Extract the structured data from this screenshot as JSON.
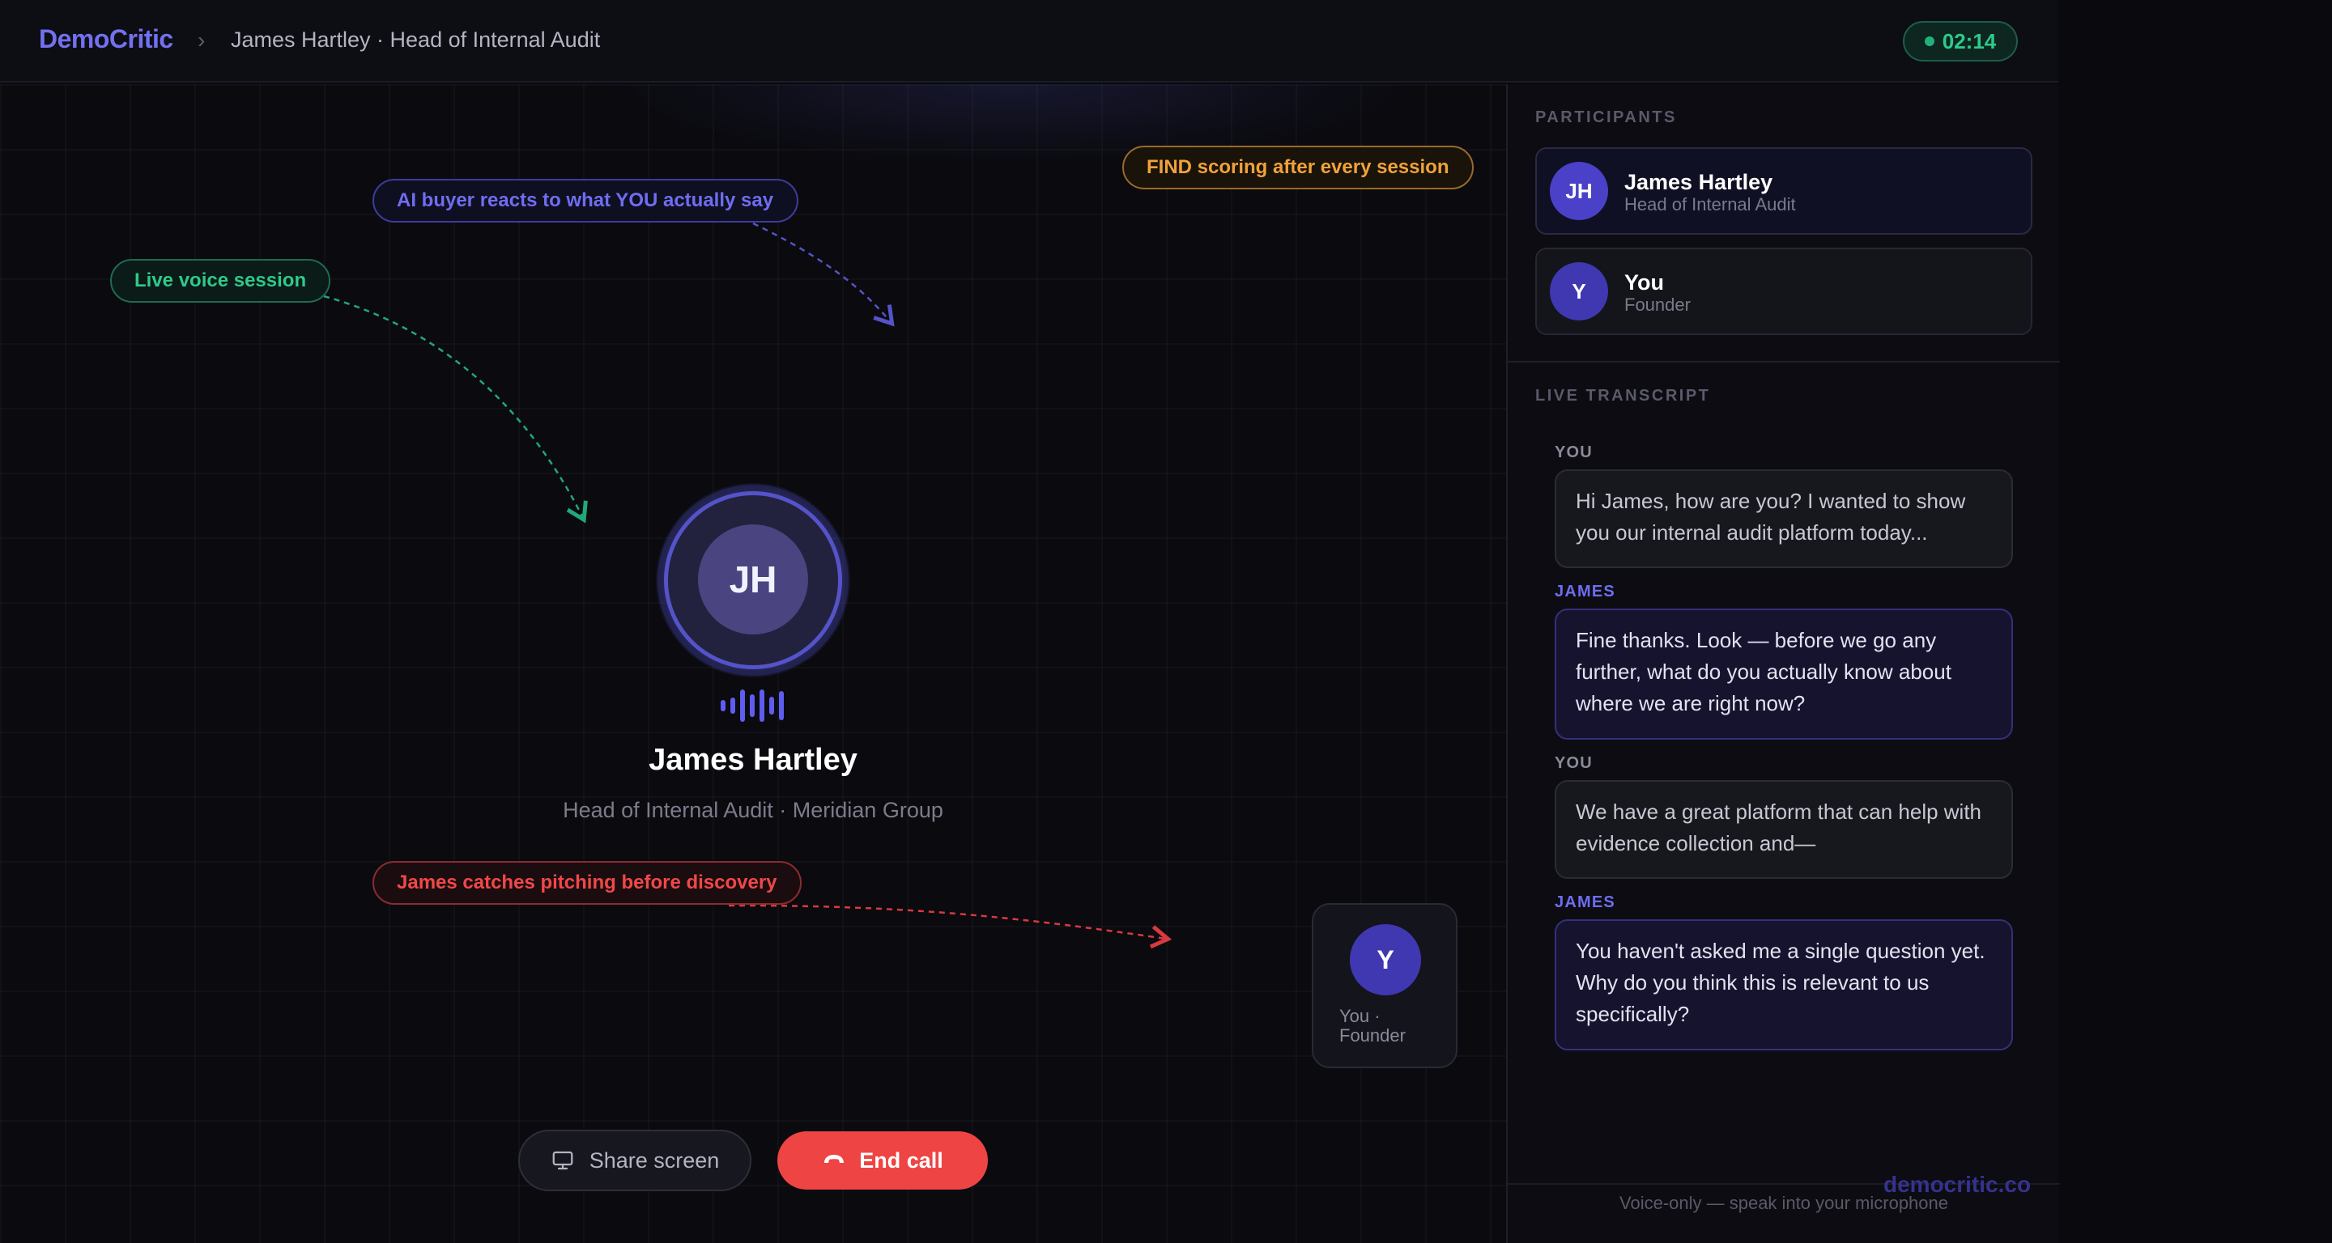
{
  "header": {
    "brand": "DemoCritic",
    "breadcrumb_separator": "›",
    "breadcrumb": "James Hartley · Head of Internal Audit",
    "timer": "02:14"
  },
  "stage": {
    "callouts": {
      "ai_buyer": "AI buyer reacts to what YOU actually say",
      "find_scoring": "FIND scoring after every session",
      "live_voice": "Live voice session",
      "pitching": "James catches pitching before discovery"
    },
    "speaker": {
      "initials": "JH",
      "name": "James Hartley",
      "role": "Head of Internal Audit · Meridian Group"
    },
    "self": {
      "initials": "Y",
      "label": "You · Founder"
    },
    "controls": {
      "share": "Share screen",
      "end": "End call"
    }
  },
  "panel": {
    "participants_title": "PARTICIPANTS",
    "participants": [
      {
        "initials": "JH",
        "name": "James Hartley",
        "role": "Head of Internal Audit"
      },
      {
        "initials": "Y",
        "name": "You",
        "role": "Founder"
      }
    ],
    "transcript_title": "LIVE TRANSCRIPT",
    "transcript": [
      {
        "speaker": "YOU",
        "text": "Hi James, how are you? I wanted to show you our internal audit platform today..."
      },
      {
        "speaker": "JAMES",
        "text": "Fine thanks. Look — before we go any further, what do you actually know about where we are right now?"
      },
      {
        "speaker": "YOU",
        "text": "We have a great platform that can help with evidence collection and—"
      },
      {
        "speaker": "JAMES",
        "text": "You haven't asked me a single question yet. Why do you think this is relevant to us specifically?"
      }
    ],
    "footer_hint": "Voice-only — speak into your microphone"
  },
  "watermark": "democritic.co",
  "colors": {
    "accent": "#6f6df0",
    "success": "#2fc98c",
    "warning": "#f0a23a",
    "danger": "#ef4444"
  },
  "icons": {
    "share": "monitor-icon",
    "end": "phone-hangup-icon",
    "timer": "live-dot-icon"
  }
}
